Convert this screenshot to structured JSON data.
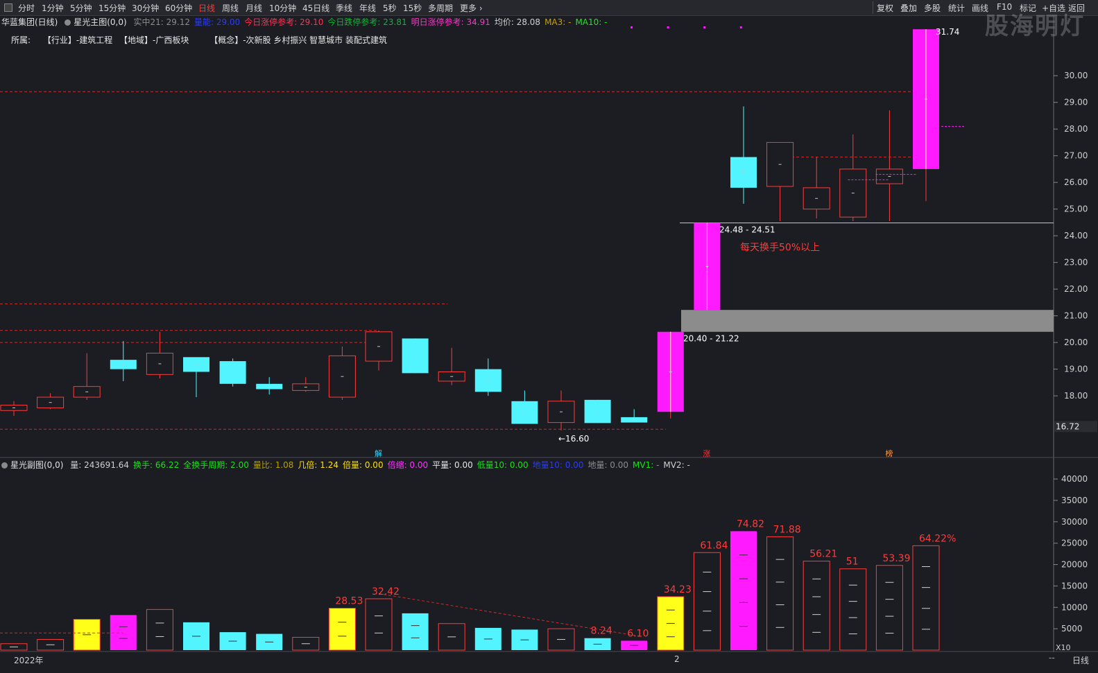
{
  "toolbar": {
    "left_items": [
      "分时",
      "1分钟",
      "5分钟",
      "15分钟",
      "30分钟",
      "60分钟",
      "日线",
      "周线",
      "月线",
      "10分钟",
      "45日线",
      "季线",
      "年线",
      "5秒",
      "15秒",
      "多周期",
      "更多"
    ],
    "active": "日线",
    "right_items": [
      "复权",
      "叠加",
      "多股",
      "统计",
      "画线",
      "F10",
      "标记",
      "+自选",
      "返回"
    ]
  },
  "watermark": "股海明灯",
  "main_info": {
    "stock": "华蓝集团(日线)",
    "indicator": "星光主图(0,0)",
    "segments": [
      {
        "text": "实中21: 29.12",
        "color": "#8c8c8c"
      },
      {
        "text": "量能: 29.00",
        "color": "#2a3cff"
      },
      {
        "text": "今日涨停参考: 29.10",
        "color": "#ff3355"
      },
      {
        "text": "今日跌停参考: 23.81",
        "color": "#19b03a"
      },
      {
        "text": "明日涨停参考: 34.91",
        "color": "#ff33cc"
      },
      {
        "text": "均价: 28.08",
        "color": "#d0d0d0"
      },
      {
        "text": "MA3: -",
        "color": "#c8a000"
      },
      {
        "text": "MA10: -",
        "color": "#28e028"
      }
    ]
  },
  "belong": {
    "label": "所属:",
    "industry": "【行业】-建筑工程",
    "region": "【地域】-广西板块",
    "concept": "【概念】-次新股 乡村振兴 智慧城市 装配式建筑"
  },
  "main_chart": {
    "y_ticks": [
      "30.00",
      "29.00",
      "28.00",
      "27.00",
      "26.00",
      "25.00",
      "24.00",
      "23.00",
      "22.00",
      "21.00",
      "20.00",
      "19.00",
      "18.00",
      "17.00"
    ],
    "current_price": "16.72",
    "candles": [
      {
        "o": 17.45,
        "c": 17.65,
        "h": 17.8,
        "l": 17.25,
        "color": "red"
      },
      {
        "o": 17.55,
        "c": 17.95,
        "h": 18.1,
        "l": 17.5,
        "color": "red"
      },
      {
        "o": 17.95,
        "c": 18.35,
        "h": 19.6,
        "l": 17.85,
        "color": "red"
      },
      {
        "o": 19.35,
        "c": 19.0,
        "h": 20.05,
        "l": 18.55,
        "color": "cyan"
      },
      {
        "o": 18.8,
        "c": 19.6,
        "h": 20.4,
        "l": 18.65,
        "color": "red"
      },
      {
        "o": 19.45,
        "c": 18.9,
        "h": 19.35,
        "l": 17.95,
        "color": "cyan"
      },
      {
        "o": 19.3,
        "c": 18.45,
        "h": 19.4,
        "l": 18.35,
        "color": "cyan"
      },
      {
        "o": 18.45,
        "c": 18.25,
        "h": 18.7,
        "l": 18.05,
        "color": "cyan"
      },
      {
        "o": 18.2,
        "c": 18.45,
        "h": 18.7,
        "l": 18.15,
        "color": "red"
      },
      {
        "o": 17.95,
        "c": 19.5,
        "h": 19.85,
        "l": 17.85,
        "color": "red"
      },
      {
        "o": 19.3,
        "c": 20.4,
        "h": 20.45,
        "l": 18.95,
        "color": "red"
      },
      {
        "o": 20.15,
        "c": 18.85,
        "h": 20.15,
        "l": 18.85,
        "color": "cyan"
      },
      {
        "o": 18.55,
        "c": 18.9,
        "h": 19.8,
        "l": 18.4,
        "color": "red"
      },
      {
        "o": 19.0,
        "c": 18.15,
        "h": 19.4,
        "l": 18.0,
        "color": "cyan"
      },
      {
        "o": 17.8,
        "c": 16.95,
        "h": 18.2,
        "l": 16.95,
        "color": "cyan"
      },
      {
        "o": 17.0,
        "c": 17.8,
        "h": 18.2,
        "l": 16.7,
        "color": "red"
      },
      {
        "o": 17.85,
        "c": 16.98,
        "h": 17.85,
        "l": 16.98,
        "color": "cyan"
      },
      {
        "o": 17.2,
        "c": 17.0,
        "h": 17.5,
        "l": 17.0,
        "color": "cyan"
      },
      {
        "o": 17.4,
        "c": 20.4,
        "h": 20.4,
        "l": 17.15,
        "color": "magenta"
      },
      {
        "o": 21.22,
        "c": 24.48,
        "h": 24.51,
        "l": 21.22,
        "color": "magenta"
      },
      {
        "o": 26.95,
        "c": 25.8,
        "h": 28.85,
        "l": 25.2,
        "color": "cyan"
      },
      {
        "o": 25.85,
        "c": 27.5,
        "h": 27.5,
        "l": 24.55,
        "color": "red"
      },
      {
        "o": 25.0,
        "c": 25.8,
        "h": 26.95,
        "l": 24.65,
        "color": "red"
      },
      {
        "o": 24.7,
        "c": 26.5,
        "h": 27.8,
        "l": 24.55,
        "color": "red"
      },
      {
        "o": 25.95,
        "c": 26.5,
        "h": 28.7,
        "l": 24.55,
        "color": "red"
      },
      {
        "o": 26.5,
        "c": 31.74,
        "h": 31.74,
        "l": 25.3,
        "color": "magenta"
      }
    ],
    "gap_zone": {
      "low": 20.4,
      "high": 21.22,
      "label": "20.40 - 21.22"
    },
    "gap_label_2": "24.48 - 24.51",
    "low_label": "←16.60",
    "high_label": "31.74",
    "annotation": "每天换手50%以上",
    "dashed_levels": [
      29.4,
      21.45,
      20.45,
      20.0,
      16.75,
      26.95
    ],
    "markers": [
      {
        "text": "解",
        "index": 10,
        "color": "#2dd6ff"
      },
      {
        "text": "涨",
        "index": 19,
        "color": "#ff3333"
      },
      {
        "text": "榜",
        "index": 24,
        "color": "#ff9933"
      }
    ]
  },
  "sub_info": {
    "indicator": "星光副图(0,0)",
    "segments": [
      {
        "text": "量: 243691.64",
        "color": "#d0d0d0"
      },
      {
        "text": "换手: 66.22",
        "color": "#19e019"
      },
      {
        "text": "全换手周期: 2.00",
        "color": "#19e019"
      },
      {
        "text": "量比: 1.08",
        "color": "#b8a000"
      },
      {
        "text": "几倍: 1.24",
        "color": "#ffe000"
      },
      {
        "text": "倍量: 0.00",
        "color": "#ffe000"
      },
      {
        "text": "倍缩: 0.00",
        "color": "#ff33ff"
      },
      {
        "text": "平量: 0.00",
        "color": "#e6e6e6"
      },
      {
        "text": "低量10: 0.00",
        "color": "#19e019"
      },
      {
        "text": "地量10: 0.00",
        "color": "#2a3cff"
      },
      {
        "text": "地量: 0.00",
        "color": "#8c8c8c"
      },
      {
        "text": "MV1: -",
        "color": "#19e019"
      },
      {
        "text": "MV2: -",
        "color": "#d0d0d0"
      }
    ]
  },
  "volume_chart": {
    "y_ticks": [
      "40000",
      "35000",
      "30000",
      "25000",
      "20000",
      "15000",
      "10000",
      "5000"
    ],
    "unit": "X10",
    "bars": [
      {
        "v": 1500,
        "color": "red"
      },
      {
        "v": 2500,
        "color": "red"
      },
      {
        "v": 7200,
        "color": "yellow"
      },
      {
        "v": 8200,
        "color": "magenta"
      },
      {
        "v": 9500,
        "color": "red"
      },
      {
        "v": 6500,
        "color": "cyan"
      },
      {
        "v": 4200,
        "color": "cyan"
      },
      {
        "v": 3800,
        "color": "cyan"
      },
      {
        "v": 3000,
        "color": "red"
      },
      {
        "v": 9800,
        "color": "yellow"
      },
      {
        "v": 12000,
        "color": "red"
      },
      {
        "v": 8600,
        "color": "cyan"
      },
      {
        "v": 6200,
        "color": "red"
      },
      {
        "v": 5200,
        "color": "cyan"
      },
      {
        "v": 4800,
        "color": "cyan"
      },
      {
        "v": 5000,
        "color": "red"
      },
      {
        "v": 2800,
        "color": "cyan"
      },
      {
        "v": 2200,
        "color": "magenta"
      },
      {
        "v": 12500,
        "color": "yellow"
      },
      {
        "v": 22800,
        "color": "red"
      },
      {
        "v": 27800,
        "color": "magenta"
      },
      {
        "v": 26500,
        "color": "red"
      },
      {
        "v": 20800,
        "color": "red"
      },
      {
        "v": 19000,
        "color": "red"
      },
      {
        "v": 19800,
        "color": "red"
      },
      {
        "v": 24400,
        "color": "red"
      }
    ],
    "labels": [
      {
        "index": 9,
        "text": "28.53"
      },
      {
        "index": 10,
        "text": "32.42"
      },
      {
        "index": 16,
        "text": "8.24"
      },
      {
        "index": 17,
        "text": "6.10"
      },
      {
        "index": 18,
        "text": "34.23"
      },
      {
        "index": 19,
        "text": "61.84"
      },
      {
        "index": 20,
        "text": "74.82"
      },
      {
        "index": 21,
        "text": "71.88"
      },
      {
        "index": 22,
        "text": "56.21"
      },
      {
        "index": 23,
        "text": "51"
      },
      {
        "index": 24,
        "text": "53.39"
      },
      {
        "index": 25,
        "text": "64.22%"
      }
    ]
  },
  "bottom": {
    "date": "2022年",
    "sep": "2",
    "dash": "--",
    "period": "日线"
  },
  "colors": {
    "red": "#ff3b3b",
    "cyan": "#52f5ff",
    "magenta": "#ff1aff",
    "yellow": "#ffff1a",
    "grid_dash": "#d42a2a",
    "gap_fill": "#8c8c8c"
  }
}
